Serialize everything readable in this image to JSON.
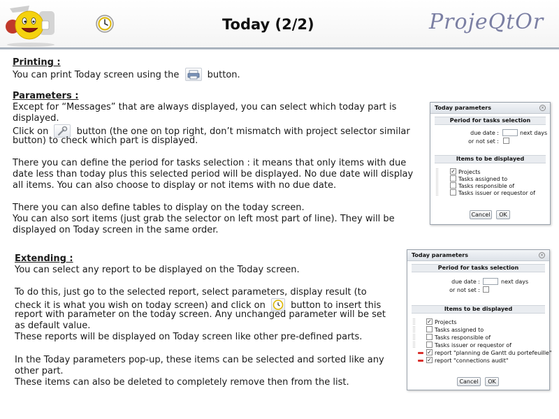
{
  "header": {
    "title": "Today (2/2)",
    "brand": "ProjeQtOr",
    "logo_icon": "smiley-mascot-icon",
    "today_icon": "today-clock-icon"
  },
  "printing": {
    "heading": "Printing :",
    "line1_before": "You can print Today screen using the",
    "line1_after": "button."
  },
  "parameters": {
    "heading": "Parameters :",
    "p1_l1": "Except for “Messages” that are always displayed, you can select which today part is",
    "p1_l2": "displayed.",
    "p1_l3_before": "Click on",
    "p1_l3_after": "button (the one on top right, don’t mismatch with project selector similar",
    "p1_l4": "button) to check which part is displayed.",
    "p2_l1": "There you can define the period for tasks selection : it means that only items with due",
    "p2_l2": "date less than today plus this selected period will be displayed. No due date will display",
    "p2_l3": "all items. You can also choose to display or not items with no due date.",
    "p3_l1": "There you can also define tables to display on the today screen.",
    "p3_l2": "You can also sort items (just grab the selector on left most part of line). They will be",
    "p3_l3": "displayed on Today screen in the same order."
  },
  "extending": {
    "heading": "Extending :",
    "p1": "You can select any report to be displayed on the Today screen.",
    "p2_l1": "To do this, just go to the selected report, select parameters, display result (to",
    "p2_l2_before": "check it is what you wish on today screen) and click on",
    "p2_l2_after": "button to insert this",
    "p2_l3": "report with parameter on the today screen. Any unchanged parameter will be set",
    "p2_l4": "as default value.",
    "p2_l5": "These reports will be displayed on Today screen like other pre-defined parts.",
    "p3_l1": "In the Today parameters pop-up, these items can be selected and sorted like any",
    "p3_l2": "other part.",
    "p3_l3": "These items can also be deleted to completely remove then from the list."
  },
  "popup1": {
    "title": "Today parameters",
    "period_section": "Period for tasks selection",
    "due_date_label": "due date :",
    "due_date_value": "",
    "next_days": "next days",
    "or_not_set": "or not set :",
    "items_section": "Items to be displayed",
    "items": [
      {
        "label": "Projects",
        "checked": true
      },
      {
        "label": "Tasks assigned to",
        "checked": false
      },
      {
        "label": "Tasks responsible of",
        "checked": false
      },
      {
        "label": "Tasks issuer or requestor of",
        "checked": false
      }
    ],
    "cancel": "Cancel",
    "ok": "OK"
  },
  "popup2": {
    "title": "Today parameters",
    "period_section": "Period for tasks selection",
    "due_date_label": "due date :",
    "due_date_value": "",
    "next_days": "next days",
    "or_not_set": "or not set :",
    "items_section": "Items to be displayed",
    "items": [
      {
        "label": "Projects",
        "checked": true
      },
      {
        "label": "Tasks assigned to",
        "checked": false
      },
      {
        "label": "Tasks responsible of",
        "checked": false
      },
      {
        "label": "Tasks issuer or requestor of",
        "checked": false
      },
      {
        "label": "report \"planning de Gantt du portefeuille\"",
        "checked": true,
        "deletable": true
      },
      {
        "label": "report \"connections audit\"",
        "checked": true,
        "deletable": true
      }
    ],
    "cancel": "Cancel",
    "ok": "OK"
  },
  "colors": {
    "brand": "#7b7fa3",
    "delete_marker": "#d9302c"
  }
}
